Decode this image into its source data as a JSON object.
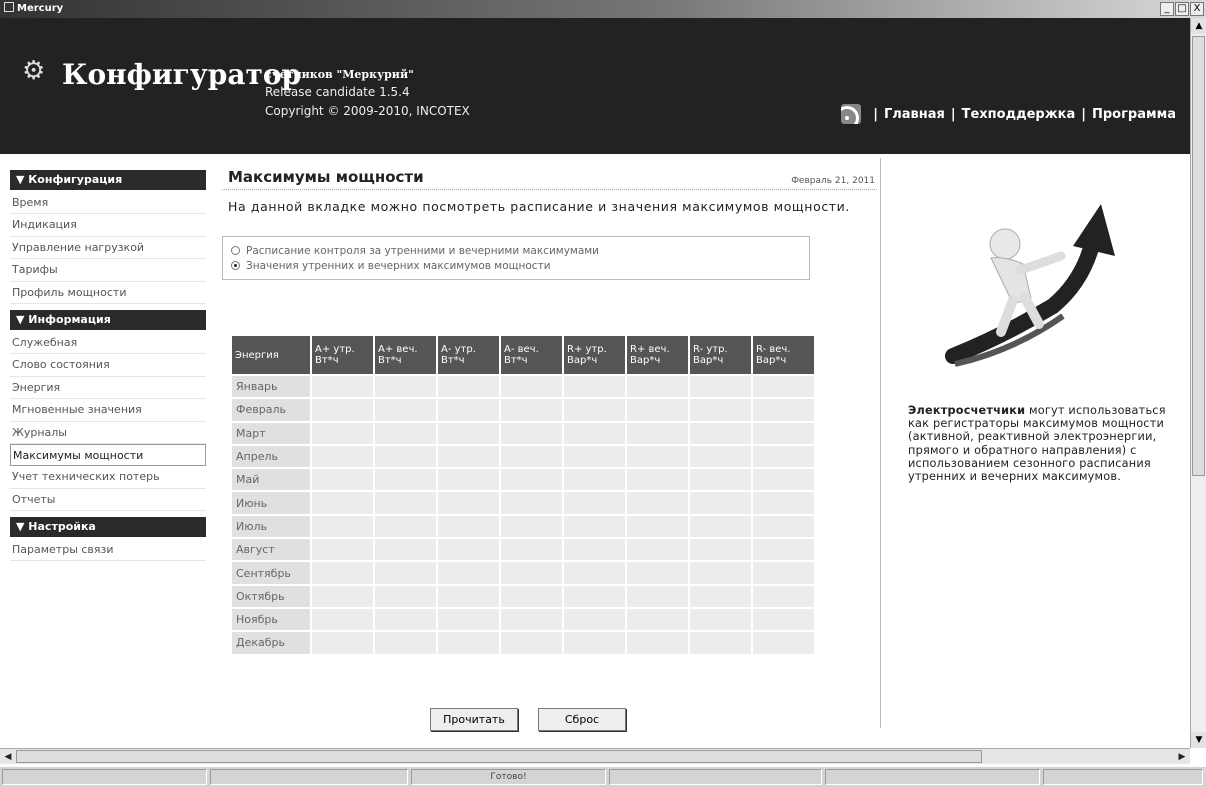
{
  "window": {
    "title": "Mercury",
    "controls": [
      "_",
      "□",
      "X"
    ]
  },
  "header": {
    "title": "Конфигуратор",
    "subtitle": "счетчиков \"Меркурий\"",
    "release": "Release candidate 1.5.4",
    "copyright": "Copyright © 2009-2010, INCOTEX",
    "nav": [
      "Главная",
      "Техподдержка",
      "Программа"
    ],
    "nav_separator": "|"
  },
  "sidebar": {
    "groups": [
      {
        "title": "▼ Конфигурация",
        "items": [
          "Время",
          "Индикация",
          "Управление нагрузкой",
          "Тарифы",
          "Профиль мощности"
        ]
      },
      {
        "title": "▼ Информация",
        "items": [
          "Служебная",
          "Слово состояния",
          "Энергия",
          "Мгновенные значения",
          "Журналы",
          "Максимумы мощности",
          "Учет технических потерь",
          "Отчеты"
        ]
      },
      {
        "title": "▼ Настройка",
        "items": [
          "Параметры связи"
        ]
      }
    ],
    "active_item": "Максимумы мощности"
  },
  "main": {
    "title": "Максимумы мощности",
    "date": "Февраль 21, 2011",
    "description": "На данной вкладке можно посмотреть расписание и значения максимумов мощности.",
    "radio_options": [
      {
        "label": "Расписание контроля за утренними и вечерними максимумами",
        "checked": false
      },
      {
        "label": "Значения утренних и вечерних максимумов мощности",
        "checked": true
      }
    ],
    "table": {
      "row_header": "Энергия",
      "columns": [
        [
          "А+ утр.",
          "Вт*ч"
        ],
        [
          "А+ веч.",
          "Вт*ч"
        ],
        [
          "А- утр.",
          "Вт*ч"
        ],
        [
          "А- веч.",
          "Вт*ч"
        ],
        [
          "R+ утр.",
          "Вар*ч"
        ],
        [
          "R+ веч.",
          "Вар*ч"
        ],
        [
          "R- утр.",
          "Вар*ч"
        ],
        [
          "R- веч.",
          "Вар*ч"
        ]
      ],
      "months": [
        "Январь",
        "Февраль",
        "Март",
        "Апрель",
        "Май",
        "Июнь",
        "Июль",
        "Август",
        "Сентябрь",
        "Октябрь",
        "Ноябрь",
        "Декабрь"
      ]
    },
    "buttons": {
      "read": "Прочитать",
      "reset": "Сброс"
    }
  },
  "promo": {
    "bold": "Электросчетчики",
    "text": " могут использоваться как регистраторы максимумов мощности (активной, реактивной электроэнергии, прямого и обратного направления) с использованием сезонного расписания утренних и вечерних максимумов.",
    "image_icon": "person-on-rising-arrow"
  },
  "statusbar": {
    "status": "Готово!"
  },
  "colors": {
    "header_bg": "#222222",
    "table_header_bg": "#555555",
    "cell_bg": "#ececec"
  }
}
